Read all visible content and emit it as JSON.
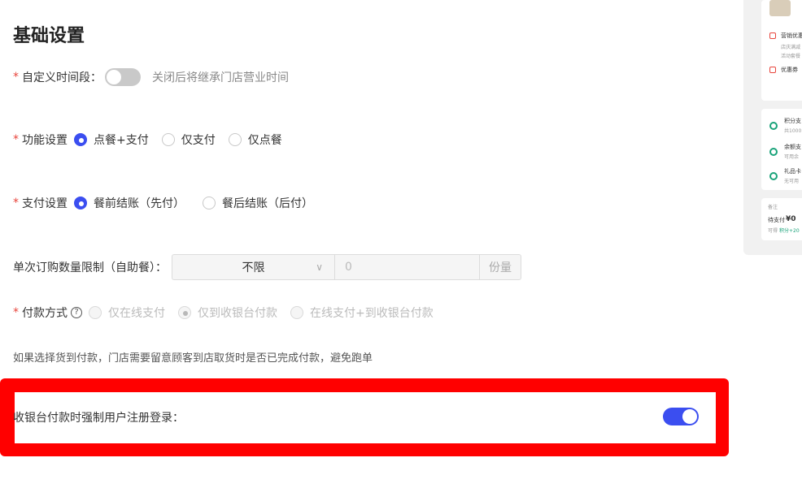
{
  "section_title": "基础设置",
  "custom_time": {
    "label": "自定义时间段：",
    "hint": "关闭后将继承门店营业时间",
    "enabled": false
  },
  "function_setting": {
    "label": "功能设置",
    "options": [
      "点餐+支付",
      "仅支付",
      "仅点餐"
    ],
    "selected": "点餐+支付"
  },
  "payment_setting": {
    "label": "支付设置",
    "options": [
      "餐前结账（先付）",
      "餐后结账（后付）"
    ],
    "selected": "餐前结账（先付）"
  },
  "order_limit": {
    "label": "单次订购数量限制（自助餐）：",
    "select_value": "不限",
    "input_placeholder": "0",
    "unit": "份量"
  },
  "pay_method": {
    "label": "付款方式",
    "help_icon": "question-circle-icon",
    "options": [
      "仅在线支付",
      "仅到收银台付款",
      "在线支付+到收银台付款"
    ],
    "selected": "仅到收银台付款",
    "disabled": true
  },
  "note": "如果选择货到付款，门店需要留意顾客到店取货时是否已完成付款，避免跑单",
  "force_login": {
    "label": "收银台付款时强制用户注册登录：",
    "enabled": true
  },
  "preview": {
    "marketing": "营销优惠",
    "marketing_sub1": "店庆满减",
    "marketing_sub2": "活动套餐",
    "coupon": "优惠券",
    "points": "积分支",
    "points_sub": "共1000",
    "balance": "余额支",
    "balance_sub": "可用余",
    "gift": "礼品卡",
    "gift_sub": "无可用",
    "remark": "备注",
    "to_pay_label": "待支付",
    "to_pay_value": "¥0",
    "points_earn": "可得",
    "points_earn_value": "积分+20"
  },
  "colors": {
    "accent": "#3b4ef0",
    "highlight": "#ff0000",
    "required": "#e8453c"
  }
}
